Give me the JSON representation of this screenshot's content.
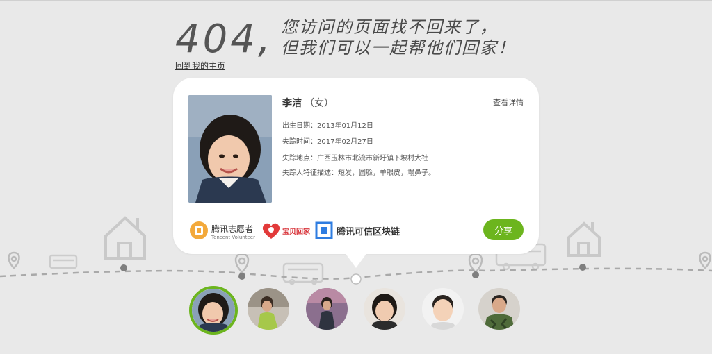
{
  "header": {
    "code": "404,",
    "line1": "您访问的页面找不回来了，",
    "line2": "但我们可以一起帮他们回家！",
    "home_link": "回到我的主页"
  },
  "card": {
    "name": "李洁",
    "gender": "（女）",
    "detail_link": "查看详情",
    "birth_label": "出生日期：",
    "birth_value": "2013年01月12日",
    "missing_time_label": "失踪时间：",
    "missing_time_value": "2017年02月27日",
    "missing_place_label": "失踪地点：",
    "missing_place_value": "广西玉林市北流市新圩镇下坡村大社",
    "features_label": "失踪人特征描述：",
    "features_value": "短发，圆脸，单眼皮，塌鼻子。",
    "share_button": "分享"
  },
  "logos": {
    "tencent_volunteer": "腾讯志愿者",
    "tencent_volunteer_en": "Tencent Volunteer",
    "baobei": "宝贝回家",
    "blockchain": "腾讯可信区块链"
  },
  "colors": {
    "accent": "#6cb51e",
    "background": "#e9e9e9",
    "card": "#ffffff"
  },
  "avatars": [
    {
      "icon": "child-photo-1",
      "active": true
    },
    {
      "icon": "child-photo-2",
      "active": false
    },
    {
      "icon": "child-photo-3",
      "active": false
    },
    {
      "icon": "child-photo-4",
      "active": false
    },
    {
      "icon": "child-photo-5",
      "active": false
    },
    {
      "icon": "child-photo-6",
      "active": false
    }
  ]
}
